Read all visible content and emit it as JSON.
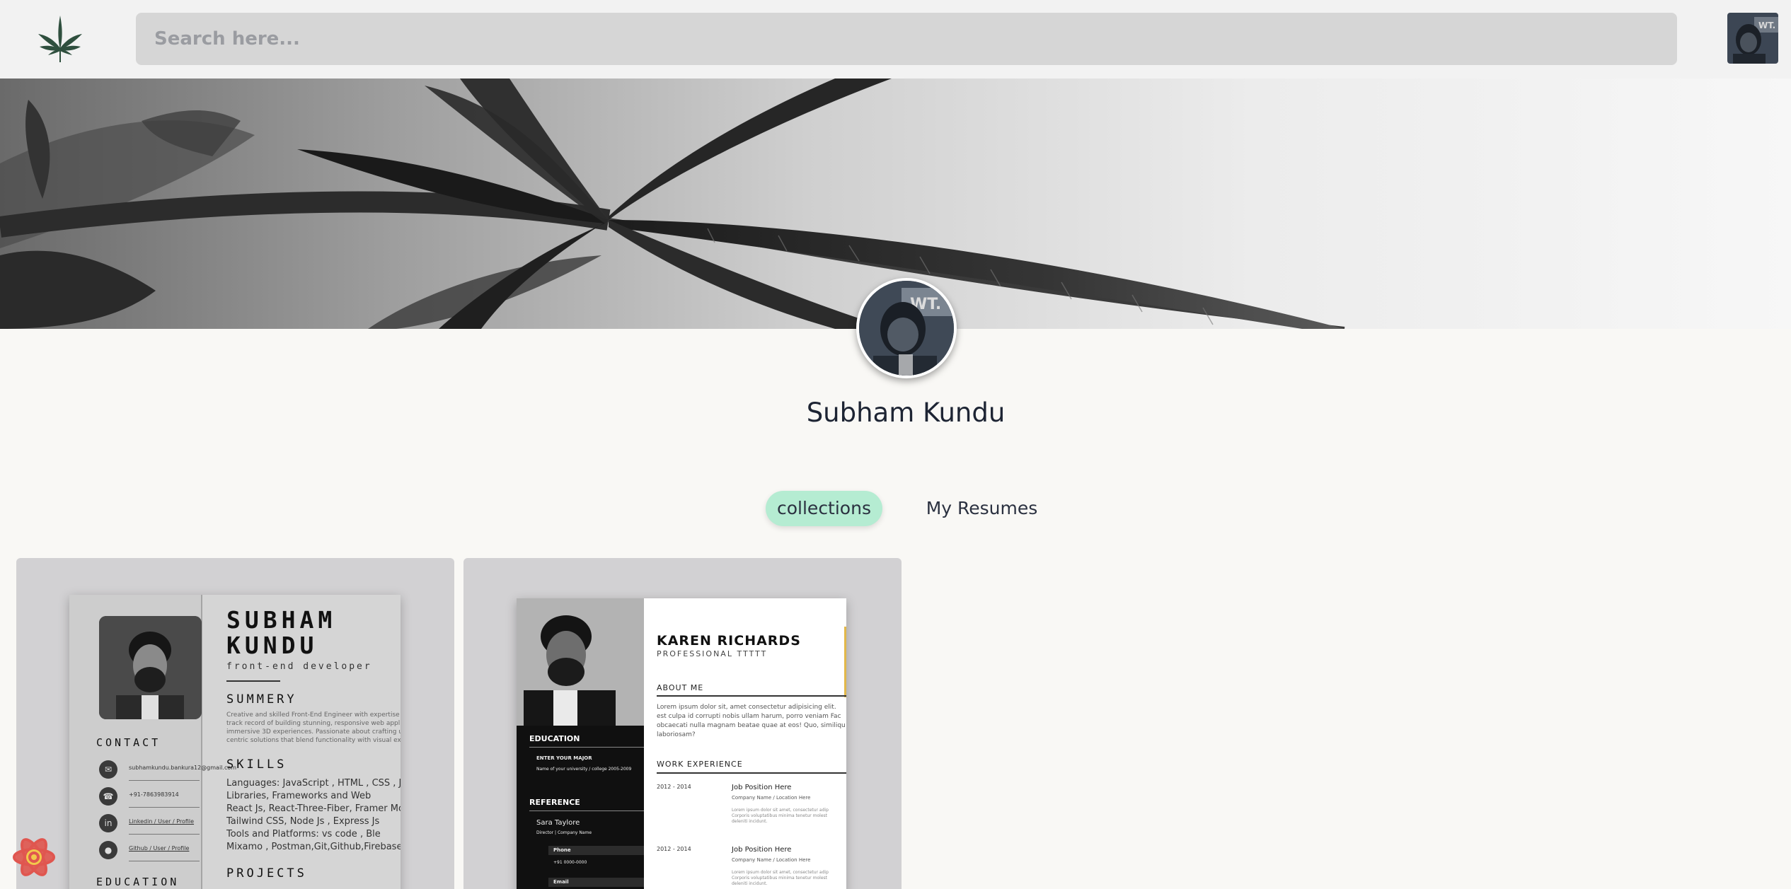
{
  "header": {
    "logo_icon": "cannabis-leaf-icon",
    "search_placeholder": "Search here...",
    "avatar_icon": "user-avatar"
  },
  "profile": {
    "name": "Subham Kundu"
  },
  "tabs": [
    {
      "label": "collections",
      "active": true
    },
    {
      "label": "My Resumes",
      "active": false
    }
  ],
  "cards": [
    {
      "name_line1": "SUBHAM",
      "name_line2": "KUNDU",
      "role": "front-end developer",
      "summary_title": "SUMMERY",
      "summary_lines": [
        "Creative and skilled Front-End Engineer with expertise",
        "track record of building stunning, responsive web appl",
        "immersive 3D experiences. Passionate about crafting u",
        "centric solutions that blend functionality with visual ex"
      ],
      "skills_title": "SKILLS",
      "skills_lines": [
        "Languages: JavaScript , HTML , CSS , J",
        "Libraries, Frameworks and Web",
        "React Js, React-Three-Fiber, Framer Motic",
        "Tailwind CSS, Node Js , Express Js",
        "Tools and Platforms: vs code , Ble",
        "Mixamo , Postman,Git,Github,Firebase,Ver"
      ],
      "projects_title": "PROJECTS",
      "contact_title": "CONTACT",
      "contacts": [
        {
          "icon": "mail-icon",
          "text": "subhamkundu.bankura12@gmail.com"
        },
        {
          "icon": "phone-icon",
          "text": "+91-7863983914"
        },
        {
          "icon": "linkedin-icon",
          "text": "Linkedin / User / Profile"
        },
        {
          "icon": "github-icon",
          "text": "Github / User / Profile"
        }
      ],
      "education_title": "EDUCATION"
    },
    {
      "name": "KAREN RICHARDS",
      "subtitle": "PROFESSIONAL TTTTT",
      "about_title": "ABOUT ME",
      "about_lines": [
        "Lorem ipsum dolor sit, amet consectetur adipisicing elit.",
        "est culpa id corrupti nobis ullam harum, porro veniam Fac",
        "obcaecati nulla magnam beatae quae at eos! Quo, similiqu",
        "laboriosam?"
      ],
      "work_title": "WORK EXPERIENCE",
      "jobs": [
        {
          "date": "2012 - 2014",
          "position": "Job Position Here",
          "company": "Company Name / Location Here"
        },
        {
          "date": "2012 - 2014",
          "position": "Job Position Here",
          "company": "Company Name / Location Here"
        }
      ],
      "job_desc_lines": [
        "Lorem ipsum dolor sit amet, consectetur adip",
        "Corporis voluptatibus minima tenetur molest",
        "deleniti incidunt."
      ],
      "education_title": "EDUCATION",
      "major": "ENTER YOUR MAJOR",
      "university": "Name of your university / college 2005-2009",
      "reference_title": "REFERENCE",
      "ref_name": "Sara Taylore",
      "ref_role": "Director | Company Name",
      "phone_label": "Phone",
      "phone_value": "+91 0000-0000",
      "email_label": "Email"
    }
  ],
  "floating_icon": "react-atom-icon",
  "colors": {
    "header_bg": "#f2f2f2",
    "search_bg": "#d6d6d6",
    "page_bg": "#f9f8f5",
    "active_tab": "#b5ecd2",
    "card_bg": "#d2d1d3",
    "resume_accent": "#e2b84a"
  }
}
